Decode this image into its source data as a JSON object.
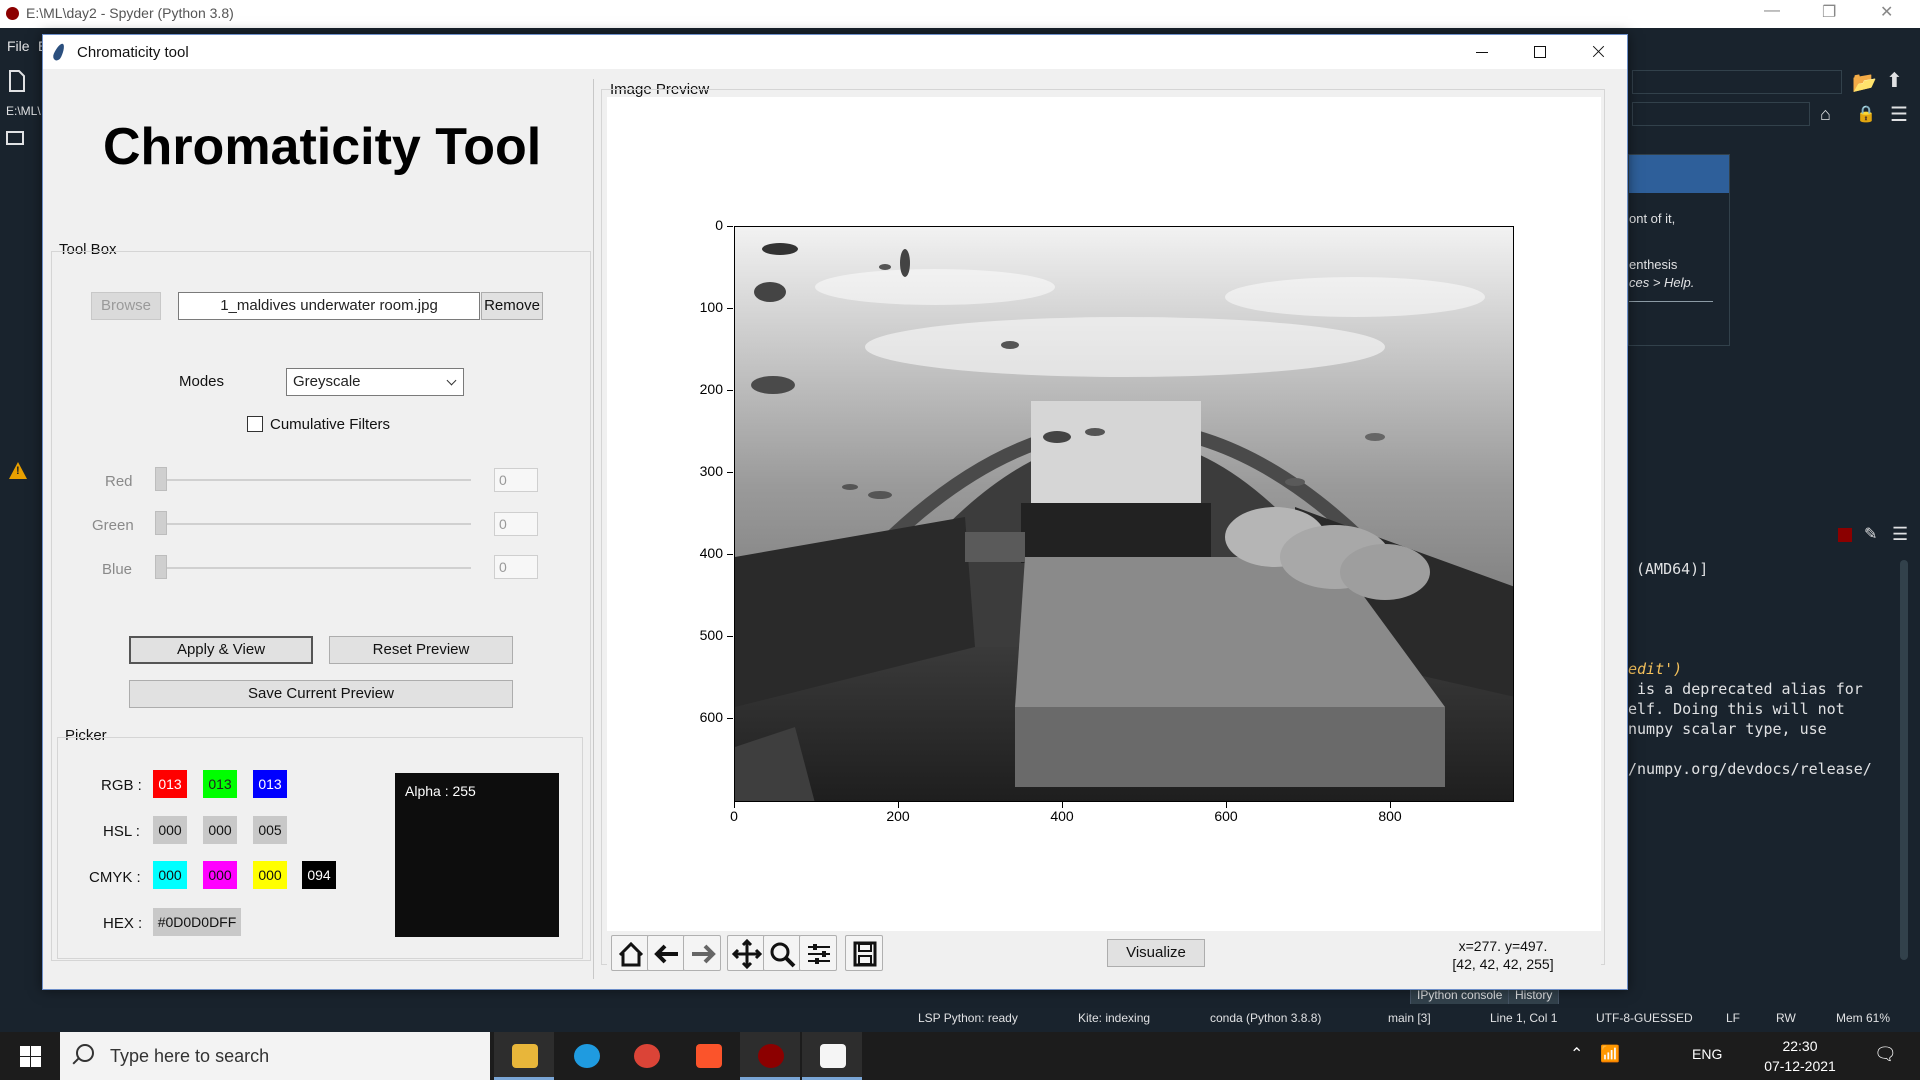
{
  "spyder": {
    "title": "E:\\ML\\day2 - Spyder (Python 3.8)",
    "menu_first": "File",
    "menu_second": "E",
    "path_short": "E:\\ML\\",
    "help_text_1": "ont of it,",
    "help_text_2": "enthesis",
    "help_text_3": "ces > Help.",
    "console_lines": [
      "(AMD64)]",
      "edit')",
      " is a deprecated alias for",
      "elf. Doing this will not",
      "numpy scalar type, use",
      "/numpy.org/devdocs/release/"
    ],
    "console_tabs": [
      "IPython console",
      "History"
    ],
    "status": {
      "lsp": "LSP Python: ready",
      "kite": "Kite: indexing",
      "conda": "conda (Python 3.8.8)",
      "git": "main [3]",
      "position": "Line 1, Col 1",
      "encoding": "UTF-8-GUESSED",
      "eol": "LF",
      "perm": "RW",
      "mem": "Mem 61%"
    }
  },
  "taskbar": {
    "search_placeholder": "Type here to search",
    "lang": "ENG",
    "time": "22:30",
    "date": "07-12-2021"
  },
  "window": {
    "title": "Chromaticity tool",
    "app_title": "Chromaticity Tool",
    "toolbox_label": "Tool Box",
    "browse_label": "Browse",
    "file_name": "1_maldives underwater room.jpg",
    "remove_label": "Remove",
    "modes_label": "Modes",
    "mode_selected": "Greyscale",
    "cumulative_label": "Cumulative Filters",
    "sliders": [
      {
        "label": "Red",
        "value": "0"
      },
      {
        "label": "Green",
        "value": "0"
      },
      {
        "label": "Blue",
        "value": "0"
      }
    ],
    "apply_label": "Apply & View",
    "reset_label": "Reset Preview",
    "save_label": "Save Current Preview",
    "picker": {
      "label": "Picker",
      "rgb_label": "RGB :",
      "rgb": [
        "013",
        "013",
        "013"
      ],
      "hsl_label": "HSL :",
      "hsl": [
        "000",
        "000",
        "005"
      ],
      "cmyk_label": "CMYK :",
      "cmyk": [
        "000",
        "000",
        "000",
        "094"
      ],
      "hex_label": "HEX :",
      "hex": "#0D0D0DFF",
      "alpha": "Alpha : 255",
      "colors": {
        "red": "#ff0000",
        "green": "#00ff00",
        "blue": "#0000ff",
        "cyan": "#00ffff",
        "magenta": "#ff00ff",
        "yellow": "#ffff00",
        "black": "#000000",
        "grey": "#c8c8c8",
        "preview": "#0d0d0d"
      }
    },
    "preview_label": "Image Preview",
    "y_ticks": [
      "0",
      "100",
      "200",
      "300",
      "400",
      "500",
      "600"
    ],
    "x_ticks": [
      "0",
      "200",
      "400",
      "600",
      "800"
    ],
    "visualize_label": "Visualize",
    "coords_line1": "x=277. y=497.",
    "coords_line2": "[42, 42, 42, 255]"
  }
}
